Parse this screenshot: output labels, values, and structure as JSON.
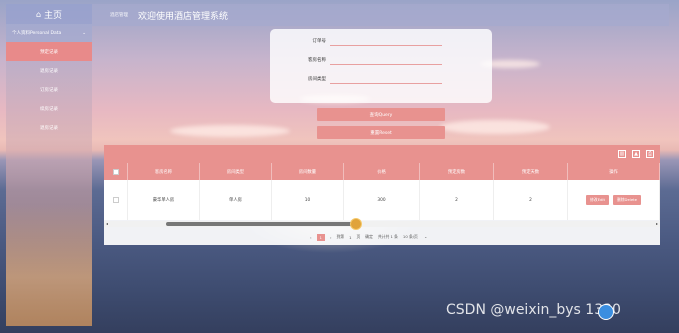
{
  "sidebar": {
    "title": "主页",
    "group": "个人资料Personal Data",
    "items": [
      {
        "label": "预定记录"
      },
      {
        "label": "退房记录"
      },
      {
        "label": "订房记录"
      },
      {
        "label": "续房记录"
      },
      {
        "label": "退房记录"
      }
    ]
  },
  "header": {
    "breadcrumb": "酒店管理",
    "system_title": "欢迎使用酒店管理系统"
  },
  "search": {
    "fields": [
      {
        "label": "订单号",
        "value": ""
      },
      {
        "label": "客房名称",
        "value": ""
      },
      {
        "label": "房间类型",
        "value": ""
      }
    ],
    "query_button": "查询Query",
    "reset_button": "重置Reset"
  },
  "table": {
    "columns": [
      "客房名称",
      "房间类型",
      "房间数量",
      "价格",
      "预定房数",
      "预定天数",
      "操作"
    ],
    "rows": [
      {
        "room_name": "豪华单人房",
        "room_type": "单人房",
        "count": "10",
        "price": "300",
        "booked": "2",
        "days": "2"
      }
    ],
    "edit_button": "修改Edit",
    "delete_button": "删除Delete"
  },
  "pager": {
    "current": "1",
    "goto_label": "到第",
    "page_suffix": "页",
    "confirm": "确定",
    "total": "共计共 1 条",
    "page_size": "10 条/页"
  },
  "watermark": "CSDN @weixin_bys 1330",
  "colors": {
    "accent": "#e8928f"
  }
}
